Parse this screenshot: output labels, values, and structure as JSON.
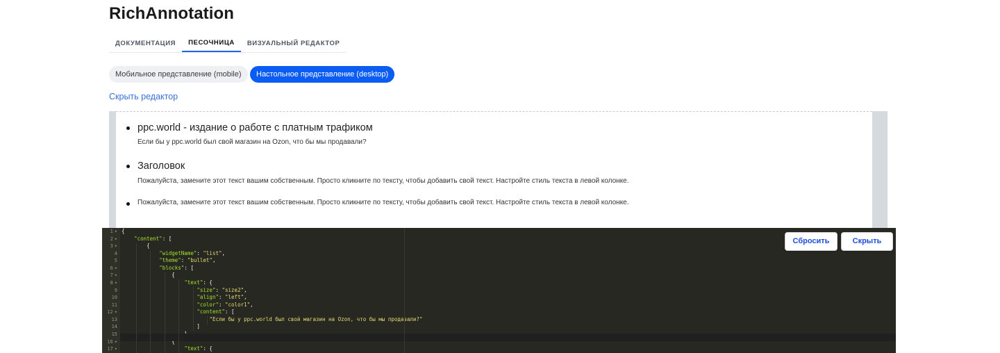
{
  "app": {
    "title": "RichAnnotation"
  },
  "tabs": [
    {
      "label": "ДОКУМЕНТАЦИЯ"
    },
    {
      "label": "ПЕСОЧНИЦА"
    },
    {
      "label": "ВИЗУАЛЬНЫЙ РЕДАКТОР"
    }
  ],
  "view_toggle": {
    "mobile_label": "Мобильное представление (mobile)",
    "desktop_label": "Настольное представление (desktop)",
    "selected": "desktop"
  },
  "hide_editor_link": "Скрыть редактор",
  "preview": {
    "items": [
      {
        "heading": "ppc.world - издание о работе с платным трафиком",
        "text": "Если бы у ppc.world был свой магазин на Ozon, что бы мы продавали?"
      },
      {
        "heading": "Заголовок",
        "text": "Пожалуйста, замените этот текст вашим собственным. Просто кликните по тексту, чтобы добавить свой текст. Настройте стиль текста в левой колонке."
      },
      {
        "heading": "",
        "text": "Пожалуйста, замените этот текст вашим собственным. Просто кликните по тексту, чтобы добавить свой текст. Настройте стиль текста в левой колонке."
      }
    ]
  },
  "editor": {
    "reset_label": "Сбросить",
    "hide_label": "Скрыть",
    "line_numbers": [
      "1",
      "2",
      "3",
      "4",
      "5",
      "6",
      "7",
      "8",
      "9",
      "10",
      "11",
      "12",
      "13",
      "14",
      "15",
      "16",
      "17"
    ],
    "code": {
      "l1": "{",
      "content_key": "\"content\"",
      "open_bracket": ": [",
      "open_brace": "{",
      "widgetName_key": "\"widgetName\"",
      "widgetName_val": "\"list\"",
      "theme_key": "\"theme\"",
      "theme_val": "\"bullet\"",
      "blocks_key": "\"blocks\"",
      "text_key": "\"text\"",
      "size_key": "\"size\"",
      "size_val": "\"size2\"",
      "align_key": "\"align\"",
      "align_val": "\"left\"",
      "color_key": "\"color\"",
      "color_val": "\"color1\"",
      "content2_key": "\"content\"",
      "string_val": "\"Если бы у ppc.world был свой магазин на Ozon, что бы мы продавали?\"",
      "close_bracket": "]",
      "close_brace_comma": "},",
      "open_brace2": "{",
      "text_key2": "\"text\""
    }
  }
}
